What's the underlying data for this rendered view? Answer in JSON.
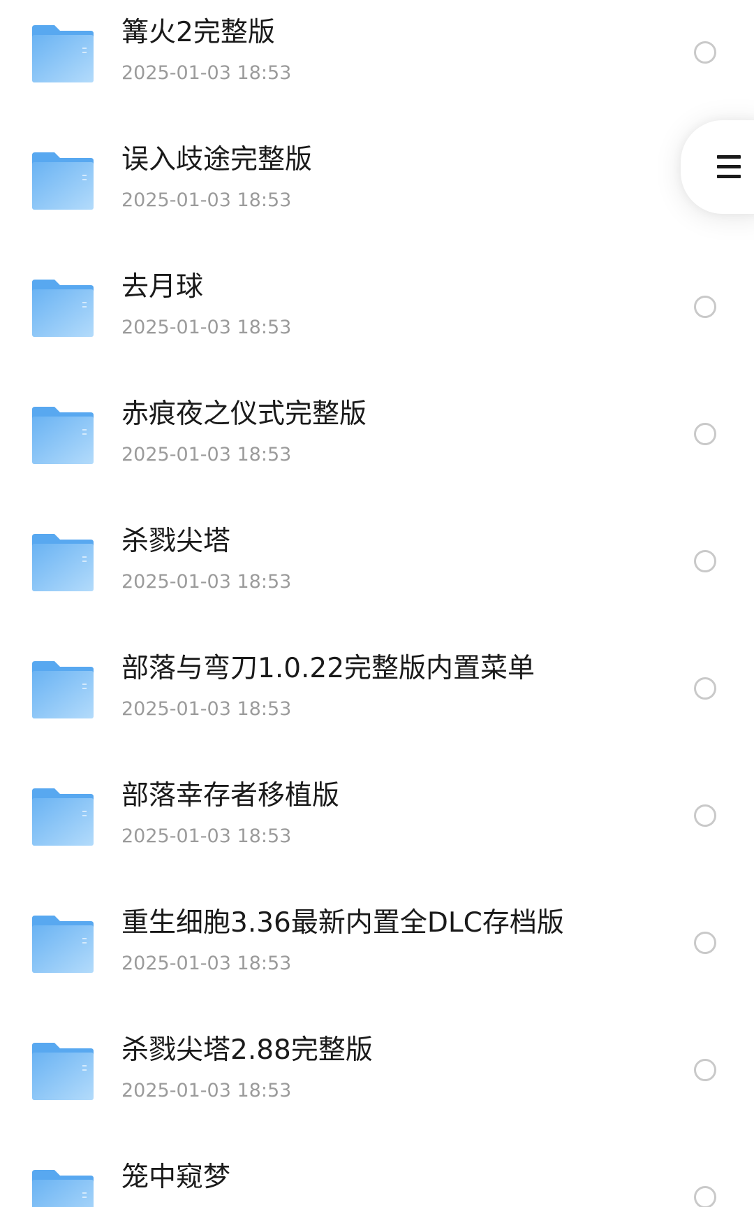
{
  "files": [
    {
      "name": "篝火2完整版",
      "date": "2025-01-03 18:53"
    },
    {
      "name": "误入歧途完整版",
      "date": "2025-01-03 18:53"
    },
    {
      "name": "去月球",
      "date": "2025-01-03 18:53"
    },
    {
      "name": "赤痕夜之仪式完整版",
      "date": "2025-01-03 18:53"
    },
    {
      "name": "杀戮尖塔",
      "date": "2025-01-03 18:53"
    },
    {
      "name": "部落与弯刀1.0.22完整版内置菜单",
      "date": "2025-01-03 18:53"
    },
    {
      "name": "部落幸存者移植版",
      "date": "2025-01-03 18:53"
    },
    {
      "name": "重生细胞3.36最新内置全DLC存档版",
      "date": "2025-01-03 18:53"
    },
    {
      "name": "杀戮尖塔2.88完整版",
      "date": "2025-01-03 18:53"
    },
    {
      "name": "笼中窥梦",
      "date": ""
    }
  ],
  "icons": {
    "folder": "folder-icon",
    "select": "radio-circle-icon",
    "menu": "hamburger-menu-icon"
  },
  "colors": {
    "folder_light": "#a9d4fb",
    "folder_dark": "#57a9f1",
    "title_text": "#1a1a1a",
    "date_text": "#9b9b9b",
    "radio_border": "#c9c9c9"
  }
}
